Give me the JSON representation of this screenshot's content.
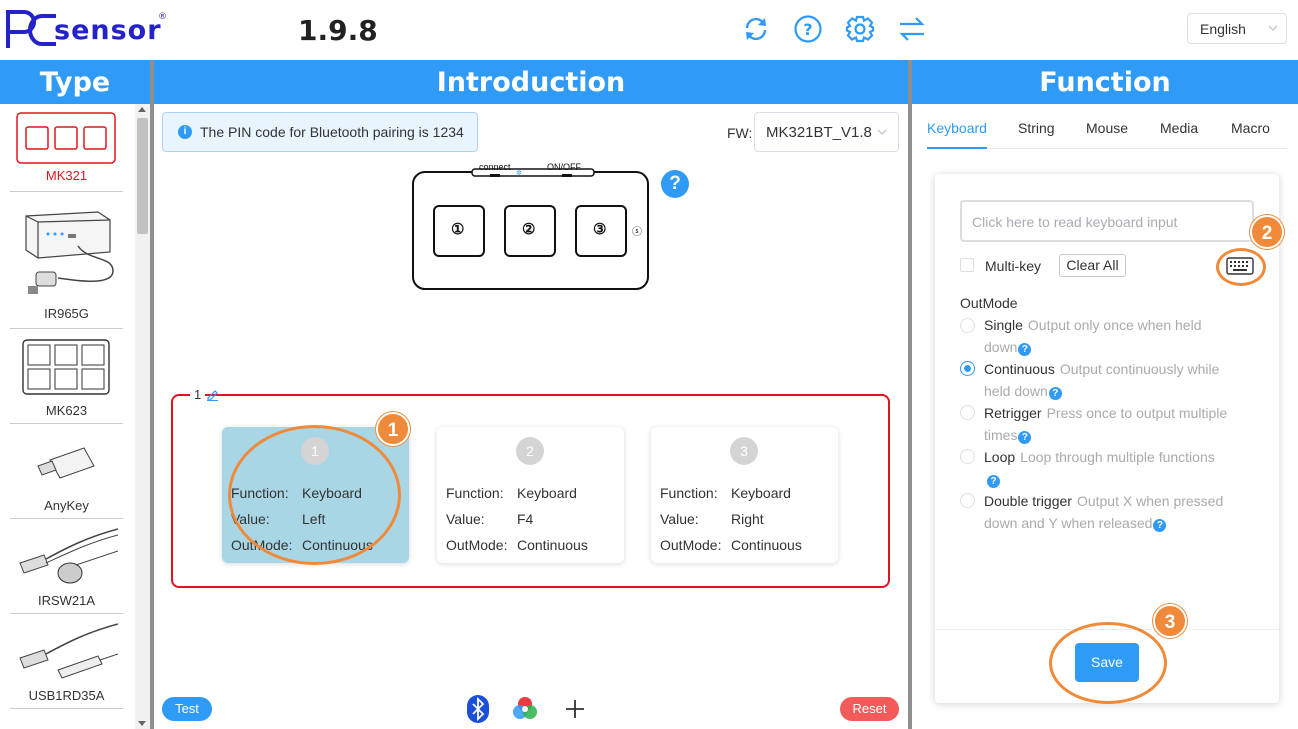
{
  "header": {
    "logo_text": "PCsensor",
    "version": "1.9.8",
    "icons": [
      "refresh-icon",
      "help-icon",
      "settings-icon",
      "swap-icon"
    ],
    "language": "English"
  },
  "columns": {
    "type": "Type",
    "introduction": "Introduction",
    "function": "Function"
  },
  "type_list": [
    {
      "label": "MK321",
      "selected": true
    },
    {
      "label": "IR965G",
      "selected": false
    },
    {
      "label": "MK623",
      "selected": false
    },
    {
      "label": "AnyKey",
      "selected": false
    },
    {
      "label": "IRSW21A",
      "selected": false
    },
    {
      "label": "USB1RD35A",
      "selected": false
    }
  ],
  "intro": {
    "pin_alert": "The PIN code for Bluetooth pairing is 1234",
    "fw_label": "FW:",
    "fw_value": "MK321BT_V1.8",
    "device": {
      "connect_label": "connect",
      "onoff_label": "ON/OFF",
      "keys": [
        "①",
        "②",
        "③"
      ],
      "side_mark": "ⓢ"
    },
    "help": "?",
    "group_label": "1",
    "keys": [
      {
        "num": "1",
        "function_label": "Function:",
        "function": "Keyboard",
        "value_label": "Value:",
        "value": "Left",
        "outmode_label": "OutMode:",
        "outmode": "Continuous",
        "active": true
      },
      {
        "num": "2",
        "function_label": "Function:",
        "function": "Keyboard",
        "value_label": "Value:",
        "value": "F4",
        "outmode_label": "OutMode:",
        "outmode": "Continuous",
        "active": false
      },
      {
        "num": "3",
        "function_label": "Function:",
        "function": "Keyboard",
        "value_label": "Value:",
        "value": "Right",
        "outmode_label": "OutMode:",
        "outmode": "Continuous",
        "active": false
      }
    ],
    "test_button": "Test",
    "reset_button": "Reset"
  },
  "function": {
    "tabs": [
      "Keyboard",
      "String",
      "Mouse",
      "Media",
      "Macro"
    ],
    "active_tab": "Keyboard",
    "input_placeholder": "Click here to read keyboard input",
    "multikey_label": "Multi-key",
    "clear_all": "Clear All",
    "outmode_title": "OutMode",
    "options": [
      {
        "name": "Single",
        "line1": "Output only once when held",
        "line2": "down",
        "checked": false
      },
      {
        "name": "Continuous",
        "line1": "Output continuously while",
        "line2": "held down",
        "checked": true
      },
      {
        "name": "Retrigger",
        "line1": "Press once to output multiple",
        "line2": "times",
        "checked": false
      },
      {
        "name": "Loop",
        "line1": "Loop through multiple functions",
        "line2": "",
        "checked": false
      },
      {
        "name": "Double trigger",
        "line1": "Output X when pressed",
        "line2": "down and Y when released",
        "checked": false
      }
    ],
    "save": "Save"
  },
  "annotations": {
    "badge_1": "1",
    "badge_2": "2",
    "badge_3": "3",
    "accent_color": "#ef8a3a"
  },
  "colors": {
    "primary": "#2f9bf7",
    "danger": "#f35b5b",
    "group_border": "#e0161f",
    "logo": "#2323c9"
  }
}
